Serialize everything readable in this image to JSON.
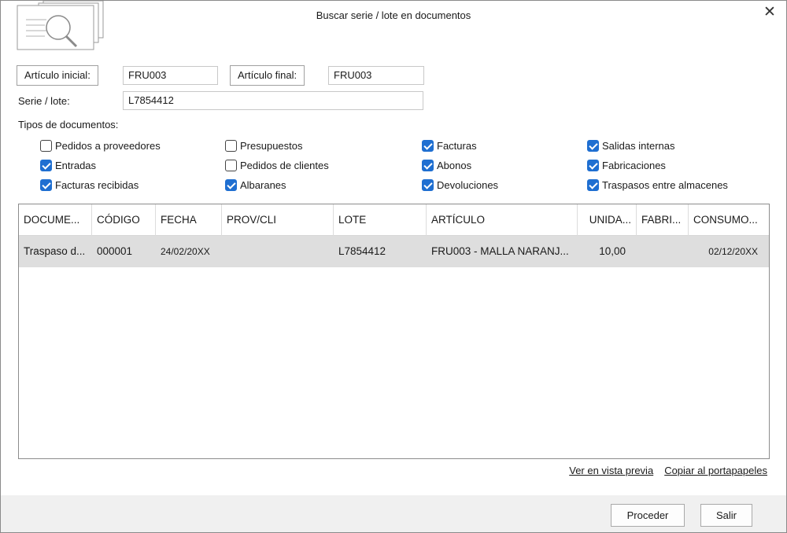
{
  "window": {
    "title": "Buscar serie / lote en documentos"
  },
  "icons": {
    "logo": "document-search-icon",
    "close": "close-icon"
  },
  "fields": {
    "articulo_inicial_label": "Artículo inicial:",
    "articulo_inicial_value": "FRU003",
    "articulo_final_label": "Artículo final:",
    "articulo_final_value": "FRU003",
    "serie_label": "Serie / lote:",
    "serie_value": "L7854412"
  },
  "tipos_title": "Tipos de documentos:",
  "checkboxes": [
    {
      "label": "Pedidos a proveedores",
      "checked": false
    },
    {
      "label": "Entradas",
      "checked": true
    },
    {
      "label": "Facturas recibidas",
      "checked": true
    },
    {
      "label": "Presupuestos",
      "checked": false
    },
    {
      "label": "Pedidos de clientes",
      "checked": false
    },
    {
      "label": "Albaranes",
      "checked": true
    },
    {
      "label": "Facturas",
      "checked": true
    },
    {
      "label": "Abonos",
      "checked": true
    },
    {
      "label": "Devoluciones",
      "checked": true
    },
    {
      "label": "Salidas internas",
      "checked": true
    },
    {
      "label": "Fabricaciones",
      "checked": true
    },
    {
      "label": "Traspasos entre almacenes",
      "checked": true
    }
  ],
  "table": {
    "columns": [
      "DOCUME...",
      "CÓDIGO",
      "FECHA",
      "PROV/CLI",
      "LOTE",
      "ARTÍCULO",
      "UNIDA...",
      "FABRI...",
      "CONSUMO..."
    ],
    "rows": [
      [
        "Traspaso d...",
        "000001",
        "24/02/20XX",
        "",
        "L7854412",
        "FRU003 - MALLA NARANJ...",
        "10,00",
        "",
        "02/12/20XX"
      ]
    ]
  },
  "links": {
    "preview": "Ver en vista previa",
    "copy": "Copiar al portapapeles"
  },
  "buttons": {
    "proceder": "Proceder",
    "salir": "Salir"
  },
  "colors": {
    "accent": "#1f6fd1",
    "selected_row": "#dedede",
    "footer": "#f0f0f0"
  }
}
